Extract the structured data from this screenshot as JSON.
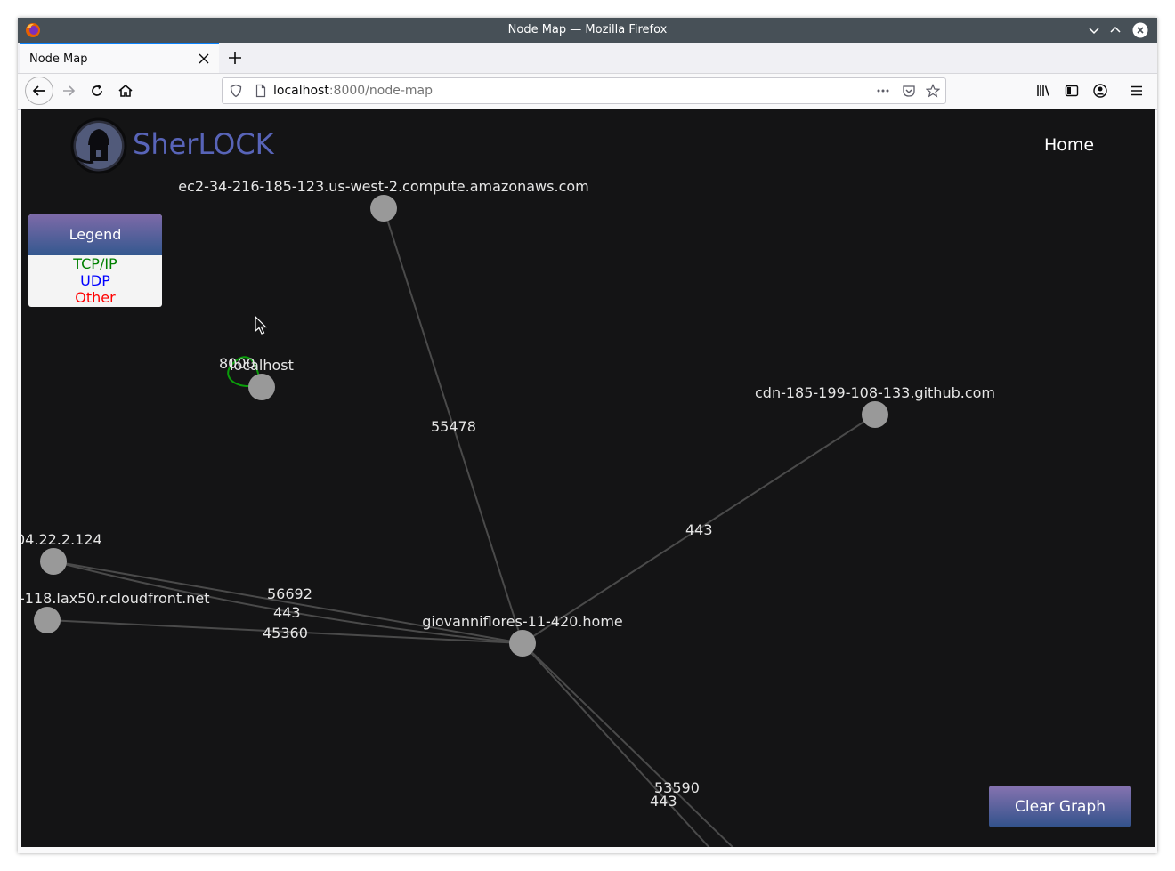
{
  "window": {
    "title": "Node Map — Mozilla Firefox"
  },
  "tabs": [
    {
      "title": "Node Map"
    }
  ],
  "navbar": {
    "url_host": "localhost",
    "url_path": ":8000/node-map"
  },
  "page": {
    "brand": "SherLOCK",
    "nav_home": "Home",
    "legend": {
      "title": "Legend",
      "items": [
        {
          "label": "TCP/IP",
          "color": "#008000"
        },
        {
          "label": "UDP",
          "color": "#0000ff"
        },
        {
          "label": "Other",
          "color": "#ff0000"
        }
      ]
    },
    "clear_button": "Clear Graph"
  },
  "graph": {
    "nodes": [
      {
        "id": "ec2",
        "label": "ec2-34-216-185-123.us-west-2.compute.amazonaws.com"
      },
      {
        "id": "localhost",
        "label": "localhost"
      },
      {
        "id": "cdn",
        "label": "cdn-185-199-108-133.github.com"
      },
      {
        "id": "ip",
        "label": "04.22.2.124"
      },
      {
        "id": "cloudfront",
        "label": "-118.lax50.r.cloudfront.net"
      },
      {
        "id": "home",
        "label": "giovanniflores-11-420.home"
      }
    ],
    "edges": [
      {
        "from": "ec2",
        "to": "home",
        "label": "55478"
      },
      {
        "from": "cdn",
        "to": "home",
        "label": "443"
      },
      {
        "from": "ip",
        "to": "home",
        "label": "56692"
      },
      {
        "from": "ip",
        "to": "home",
        "label": "443"
      },
      {
        "from": "cloudfront",
        "to": "home",
        "label": "45360"
      },
      {
        "from": "home",
        "to": "offscreen-1",
        "label": "53590"
      },
      {
        "from": "home",
        "to": "offscreen-2",
        "label": "443"
      },
      {
        "from": "localhost",
        "to": "localhost",
        "label": "8000",
        "protocol": "TCP/IP"
      }
    ],
    "edge_color": "#4a4a4a",
    "node_color": "#999999"
  }
}
